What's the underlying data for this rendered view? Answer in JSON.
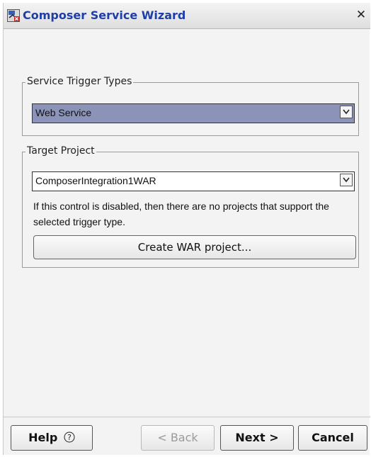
{
  "window": {
    "title": "Composer Service Wizard",
    "close_glyph": "✕",
    "icon": "composer-wizard-icon"
  },
  "service_trigger": {
    "legend": "Service Trigger Types",
    "selected": "Web Service"
  },
  "target_project": {
    "legend": "Target Project",
    "selected": "ComposerIntegration1WAR",
    "hint": "If this control is disabled, then there are no projects that support the selected trigger type.",
    "create_button": "Create WAR project..."
  },
  "footer": {
    "help_label": "Help",
    "help_icon": "?",
    "back_label": "< Back",
    "next_label": "Next >",
    "cancel_label": "Cancel"
  },
  "colors": {
    "title_text": "#1f3fa8",
    "selected_combo_bg": "#8c93b8",
    "dialog_bg": "#f3f3f3"
  }
}
